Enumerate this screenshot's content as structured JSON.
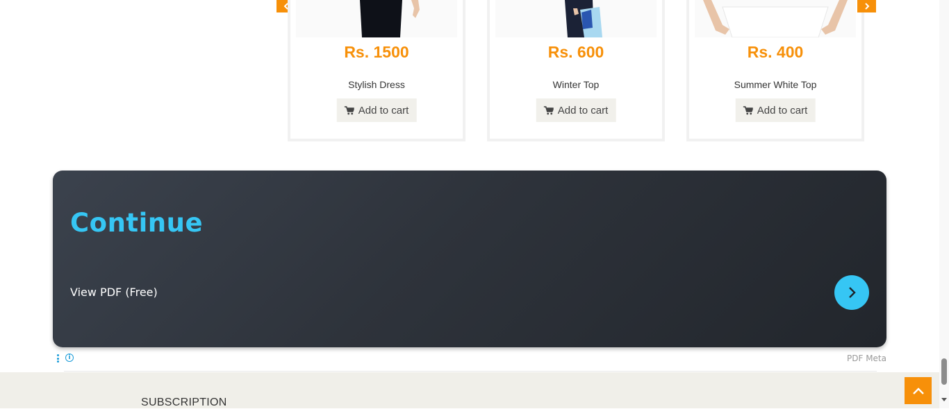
{
  "carousel": {
    "products": [
      {
        "price": "Rs. 1500",
        "name": "Stylish Dress",
        "cart_label": "Add to cart"
      },
      {
        "price": "Rs. 600",
        "name": "Winter Top",
        "cart_label": "Add to cart"
      },
      {
        "price": "Rs. 400",
        "name": "Summer White Top",
        "cart_label": "Add to cart"
      }
    ],
    "prev_icon": "chevron-left-icon",
    "next_icon": "chevron-right-icon"
  },
  "banner": {
    "title": "Continue",
    "link_text": "View PDF (Free)",
    "button_icon": "chevron-right-icon"
  },
  "ad_meta": {
    "label": "PDF Meta",
    "info_glyph": "i"
  },
  "footer": {
    "subscription_title": "SUBSCRIPTION"
  },
  "colors": {
    "accent": "#f79009",
    "banner_accent": "#36c6f4",
    "banner_bg": "#2e333b",
    "footer_bg": "#f0efe9"
  }
}
